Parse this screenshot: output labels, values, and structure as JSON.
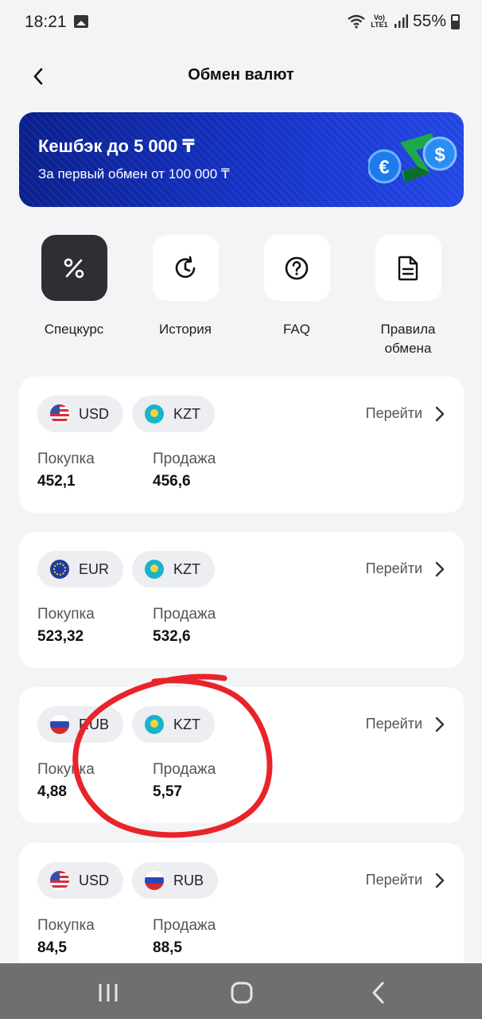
{
  "status_bar": {
    "time": "18:21",
    "network": "Vo) LTE1",
    "battery": "55%"
  },
  "header": {
    "title": "Обмен валют"
  },
  "banner": {
    "headline": "Кешбэк до 5 000 ₸",
    "subtitle": "За первый обмен от 100 000 ₸",
    "euro_symbol": "€",
    "dollar_symbol": "$"
  },
  "actions": [
    {
      "label": "Спецкурс",
      "icon": "percent-icon"
    },
    {
      "label": "История",
      "icon": "history-icon"
    },
    {
      "label": "FAQ",
      "icon": "question-icon"
    },
    {
      "label": "Правила обмена",
      "icon": "document-icon"
    }
  ],
  "buy_label": "Покупка",
  "sell_label": "Продажа",
  "go_label": "Перейти",
  "pairs": [
    {
      "from": "USD",
      "to": "KZT",
      "buy": "452,1",
      "sell": "456,6"
    },
    {
      "from": "EUR",
      "to": "KZT",
      "buy": "523,32",
      "sell": "532,6"
    },
    {
      "from": "RUB",
      "to": "KZT",
      "buy": "4,88",
      "sell": "5,57"
    },
    {
      "from": "USD",
      "to": "RUB",
      "buy": "84,5",
      "sell": "88,5"
    }
  ],
  "colors": {
    "banner": "#1533c8",
    "annotation": "#e8242a",
    "dark_tile": "#2e2f33"
  }
}
